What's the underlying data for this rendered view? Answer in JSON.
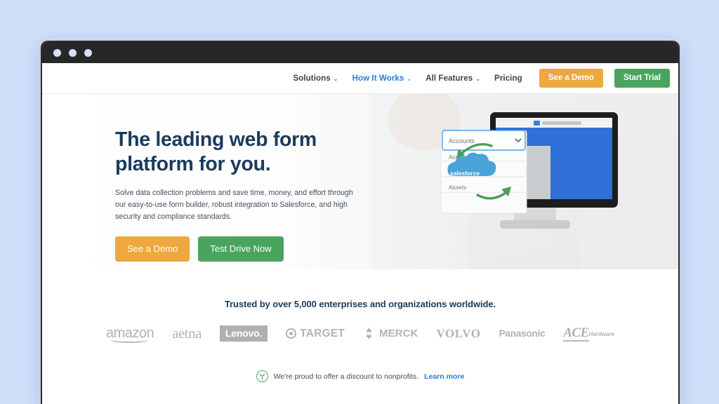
{
  "window": {
    "traffic_lights": [
      "close",
      "minimize",
      "maximize"
    ]
  },
  "nav": {
    "links": [
      {
        "label": "Solutions",
        "has_caret": true,
        "active": false
      },
      {
        "label": "How It Works",
        "has_caret": true,
        "active": true
      },
      {
        "label": "All Features",
        "has_caret": true,
        "active": false
      },
      {
        "label": "Pricing",
        "has_caret": false,
        "active": false
      }
    ],
    "caret_glyph": "⌄",
    "demo_button": "See a Demo",
    "trial_button": "Start Trial",
    "demo_color": "#eda83e",
    "trial_color": "#4ba45e",
    "active_color": "#2b7bd4"
  },
  "hero": {
    "title_line1": "The leading web form",
    "title_line2": "platform for you.",
    "subtitle": "Solve data collection problems and save time, money, and effort through our easy-to-use form builder, robust integration to Salesforce, and high security and compliance standards.",
    "primary_button": "See a Demo",
    "secondary_button": "Test Drive Now",
    "title_color": "#1b3a5c",
    "art": {
      "cloud_label": "salesforce",
      "cloud_color": "#4aa3da",
      "arrow_color": "#4a9e56",
      "select_value": "Accounts",
      "select_caret": "⌄",
      "options": [
        "Accounts",
        "Applications",
        "Assets"
      ],
      "screen_color": "#2f6fd8"
    }
  },
  "trusted": {
    "title": "Trusted by over 5,000 enterprises and organizations worldwide.",
    "logos": [
      {
        "name": "amazon",
        "text": "amazon"
      },
      {
        "name": "aetna",
        "text": "aetna"
      },
      {
        "name": "lenovo",
        "text": "Lenovo."
      },
      {
        "name": "target",
        "text": "TARGET"
      },
      {
        "name": "merck",
        "text": "MERCK"
      },
      {
        "name": "volvo",
        "text": "VOLVO"
      },
      {
        "name": "panasonic",
        "text": "Panasonic"
      },
      {
        "name": "ace-hardware",
        "text": "ACE",
        "subtext": "Hardware"
      }
    ]
  },
  "nonprofit": {
    "icon": "sprout-icon",
    "text": "We're proud to offer a discount to nonprofits.",
    "link_text": "Learn more",
    "link_color": "#2b7bd4",
    "icon_color": "#5aa95f"
  }
}
